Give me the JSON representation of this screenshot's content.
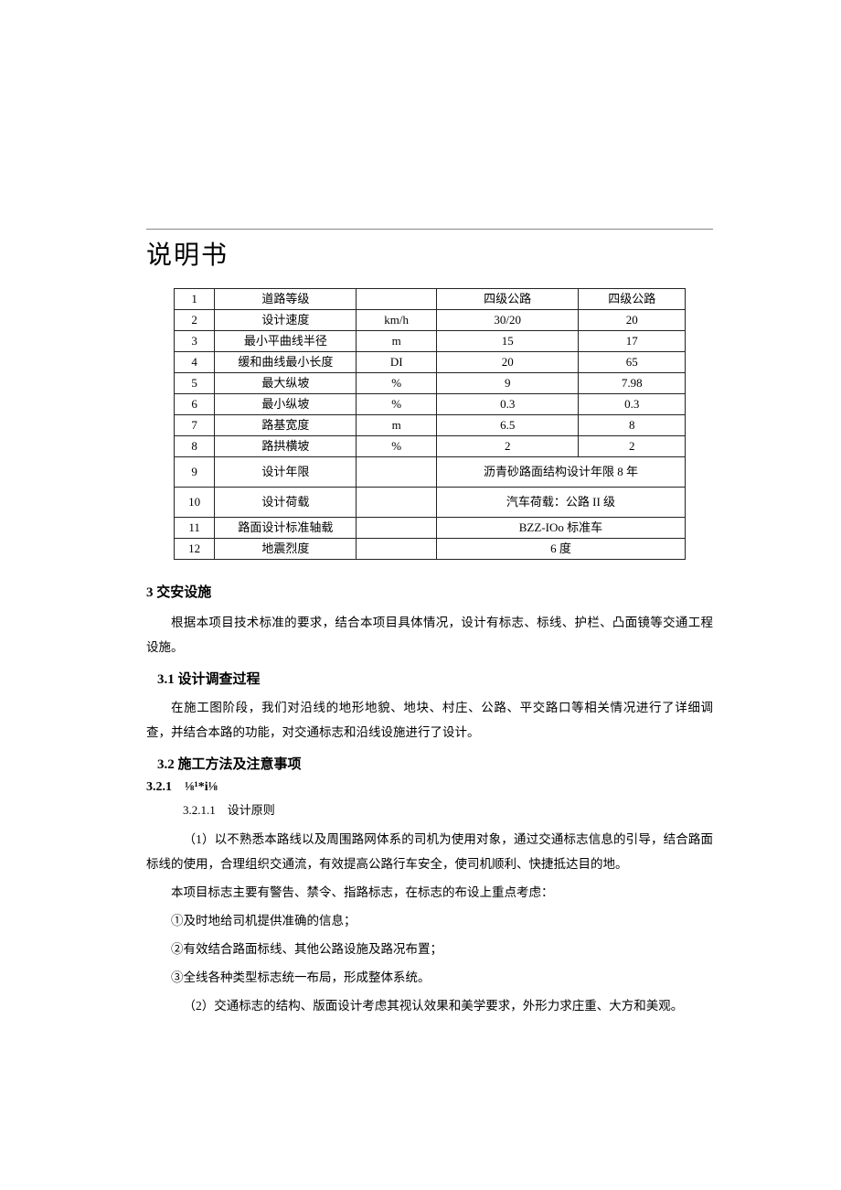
{
  "title": "说明书",
  "table": {
    "rows": [
      {
        "idx": "1",
        "item": "道路等级",
        "unit": "",
        "v1": "四级公路",
        "v2": "四级公路"
      },
      {
        "idx": "2",
        "item": "设计速度",
        "unit": "km/h",
        "v1": "30/20",
        "v2": "20"
      },
      {
        "idx": "3",
        "item": "最小平曲线半径",
        "unit": "m",
        "v1": "15",
        "v2": "17"
      },
      {
        "idx": "4",
        "item": "缓和曲线最小长度",
        "unit": "DI",
        "v1": "20",
        "v2": "65"
      },
      {
        "idx": "5",
        "item": "最大纵坡",
        "unit": "%",
        "v1": "9",
        "v2": "7.98"
      },
      {
        "idx": "6",
        "item": "最小纵坡",
        "unit": "%",
        "v1": "0.3",
        "v2": "0.3"
      },
      {
        "idx": "7",
        "item": "路基宽度",
        "unit": "m",
        "v1": "6.5",
        "v2": "8"
      },
      {
        "idx": "8",
        "item": "路拱横坡",
        "unit": "%",
        "v1": "2",
        "v2": "2"
      }
    ],
    "merged": [
      {
        "idx": "9",
        "item": "设计年限",
        "unit": "",
        "val": "沥青砂路面结构设计年限 8 年",
        "tall": true
      },
      {
        "idx": "10",
        "item": "设计荷载",
        "unit": "",
        "val": "汽车荷载：公路 II 级",
        "tall": true
      },
      {
        "idx": "11",
        "item": "路面设计标准轴载",
        "unit": "",
        "val": "BZZ-IOo 标准车",
        "tall": false
      },
      {
        "idx": "12",
        "item": "地震烈度",
        "unit": "",
        "val": "6 度",
        "tall": false
      }
    ]
  },
  "sections": {
    "s3_title": "3 交安设施",
    "s3_p1": "根据本项目技术标准的要求，结合本项目具体情况，设计有标志、标线、护栏、凸面镜等交通工程设施。",
    "s31_title": "3.1 设计调查过程",
    "s31_p1": "在施工图阶段，我们对沿线的地形地貌、地块、村庄、公路、平交路口等相关情况进行了详细调查，并结合本路的功能，对交通标志和沿线设施进行了设计。",
    "s32_title": "3.2 施工方法及注意事项",
    "s321_title": "3.2.1 ⅛¹*i⅛",
    "s3211_title": "3.2.1.1 设计原则",
    "s3211_p1": "（1）以不熟悉本路线以及周围路网体系的司机为使用对象，通过交通标志信息的引导，结合路面标线的使用，合理组织交通流，有效提高公路行车安全，使司机顺利、快捷抵达目的地。",
    "s3211_p2": "本项目标志主要有警告、禁令、指路标志，在标志的布设上重点考虑：",
    "s3211_li1": "①及时地给司机提供准确的信息；",
    "s3211_li2": "②有效结合路面标线、其他公路设施及路况布置；",
    "s3211_li3": "③全线各种类型标志统一布局，形成整体系统。",
    "s3211_p3": "（2）交通标志的结构、版面设计考虑其视认效果和美学要求，外形力求庄重、大方和美观。"
  }
}
